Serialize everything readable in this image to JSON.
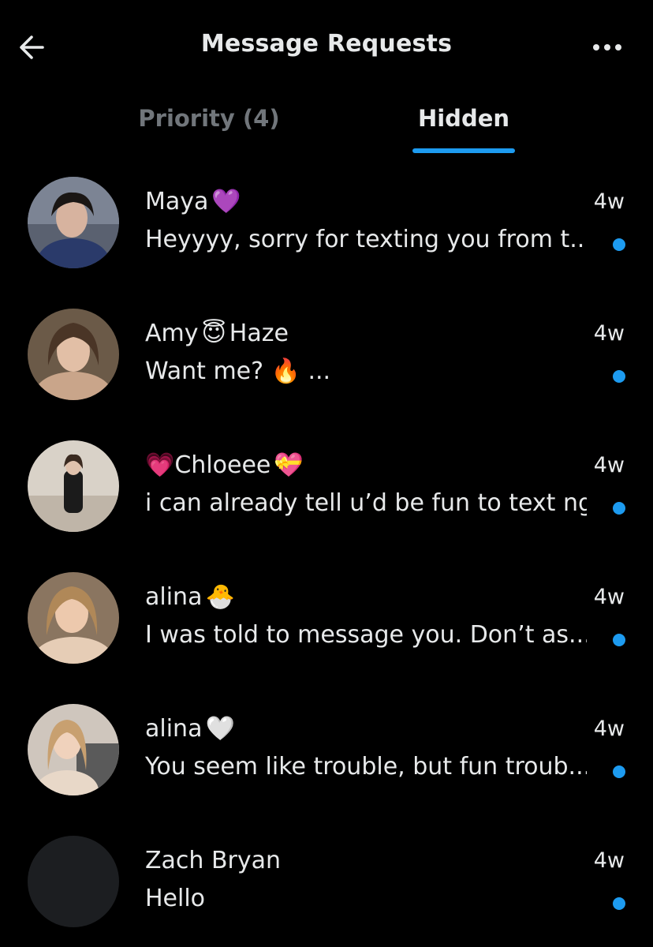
{
  "header": {
    "title": "Message Requests",
    "back_icon": "arrow-left-icon",
    "more_icon": "more-horizontal-icon"
  },
  "tabs": [
    {
      "label": "Priority (4)",
      "active": false
    },
    {
      "label": "Hidden",
      "active": true
    }
  ],
  "colors": {
    "background": "#000000",
    "text": "#e7e9ea",
    "muted": "#71767b",
    "accent": "#1d9bf0"
  },
  "requests": [
    {
      "name_before": "Maya",
      "name_emoji": "💜",
      "name_after": "",
      "time": "4w",
      "preview": "Heyyyy, sorry for texting you from t...",
      "unread": true
    },
    {
      "name_before": "Amy",
      "name_emoji": "😇",
      "name_after": "Haze",
      "time": "4w",
      "preview": "Want me? 🔥 ...",
      "unread": true
    },
    {
      "name_before": "💗Chloeee",
      "name_emoji": "💝",
      "name_after": "",
      "time": "4w",
      "preview": "i can already tell u’d be fun to text ngl",
      "unread": true
    },
    {
      "name_before": "alina",
      "name_emoji": "🐣",
      "name_after": "",
      "time": "4w",
      "preview": "I was told to message you. Don’t as...",
      "unread": true
    },
    {
      "name_before": "alina",
      "name_emoji": "🤍",
      "name_after": "",
      "time": "4w",
      "preview": "You seem like trouble, but fun troub...",
      "unread": true
    },
    {
      "name_before": "Zach Bryan",
      "name_emoji": "",
      "name_after": "",
      "time": "4w",
      "preview": "Hello",
      "unread": true
    }
  ]
}
